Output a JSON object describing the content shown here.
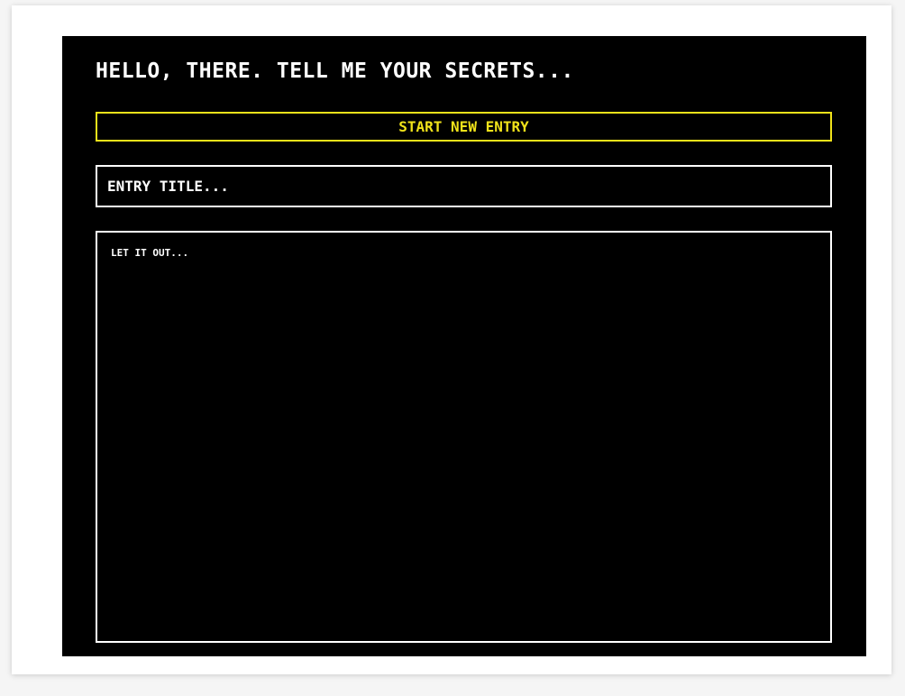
{
  "header": {
    "title": "HELLO, THERE. TELL ME YOUR SECRETS..."
  },
  "actions": {
    "start_new_entry_label": "START NEW ENTRY"
  },
  "entry": {
    "title_placeholder": "ENTRY TITLE...",
    "title_value": "",
    "body_placeholder": "LET IT OUT...",
    "body_value": ""
  },
  "colors": {
    "background": "#000000",
    "text": "#ffffff",
    "accent": "#f0e21a"
  }
}
